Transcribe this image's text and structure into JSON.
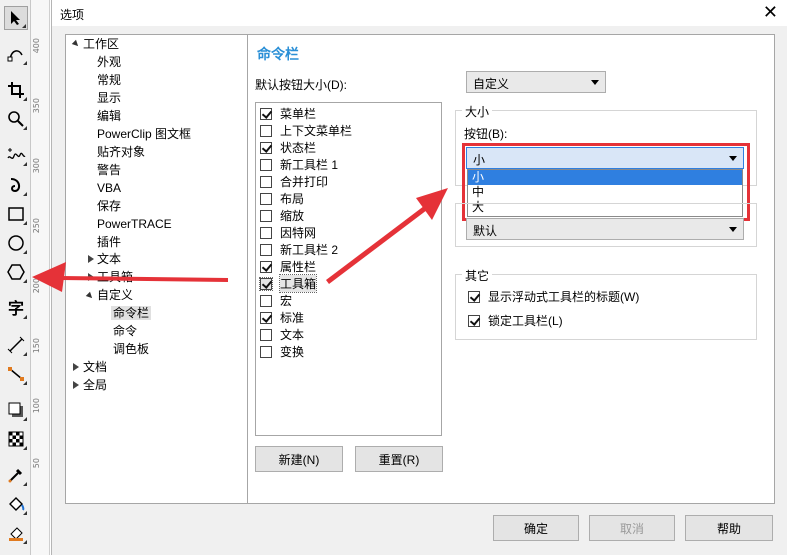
{
  "window": {
    "title": "选项"
  },
  "tree": {
    "nodes": [
      {
        "label": "工作区"
      },
      {
        "label": "外观"
      },
      {
        "label": "常规"
      },
      {
        "label": "显示"
      },
      {
        "label": "编辑"
      },
      {
        "label": "PowerClip 图文框"
      },
      {
        "label": "贴齐对象"
      },
      {
        "label": "警告"
      },
      {
        "label": "VBA"
      },
      {
        "label": "保存"
      },
      {
        "label": "PowerTRACE"
      },
      {
        "label": "插件"
      },
      {
        "label": "文本"
      },
      {
        "label": "工具箱"
      },
      {
        "label": "自定义"
      },
      {
        "label": "命令栏"
      },
      {
        "label": "命令"
      },
      {
        "label": "调色板"
      },
      {
        "label": "文档"
      },
      {
        "label": "全局"
      }
    ]
  },
  "panel": {
    "title": "命令栏",
    "default_size_label": "默认按钮大小(D):",
    "default_size_value": "自定义",
    "commandbars": [
      {
        "label": "菜单栏",
        "checked": true
      },
      {
        "label": "上下文菜单栏",
        "checked": false
      },
      {
        "label": "状态栏",
        "checked": true
      },
      {
        "label": "新工具栏 1",
        "checked": false
      },
      {
        "label": "合并打印",
        "checked": false
      },
      {
        "label": "布局",
        "checked": false
      },
      {
        "label": "缩放",
        "checked": false
      },
      {
        "label": "因特网",
        "checked": false
      },
      {
        "label": "新工具栏 2",
        "checked": false
      },
      {
        "label": "属性栏",
        "checked": true
      },
      {
        "label": "工具箱",
        "checked": true
      },
      {
        "label": "宏",
        "checked": false
      },
      {
        "label": "标准",
        "checked": true
      },
      {
        "label": "文本",
        "checked": false
      },
      {
        "label": "变换",
        "checked": false
      }
    ],
    "new_button": "新建(N)",
    "reset_button": "重置(R)",
    "size_group": {
      "title": "大小",
      "buttons_label": "按钮(B):",
      "buttons_value": "小",
      "options": [
        "小",
        "中",
        "大"
      ],
      "second_value": "默认"
    },
    "other_group": {
      "title": "其它",
      "show_floating_title": "显示浮动式工具栏的标题(W)",
      "lock_toolbar": "锁定工具栏(L)"
    }
  },
  "footer": {
    "ok": "确定",
    "cancel": "取消",
    "help": "帮助"
  },
  "ruler": {
    "numbers": [
      "400",
      "350",
      "300",
      "250",
      "200",
      "150",
      "100",
      "50"
    ]
  },
  "colors": {
    "accent": "#2a8fd6",
    "annotation": "#e53238",
    "selection": "#2f7fe0"
  }
}
